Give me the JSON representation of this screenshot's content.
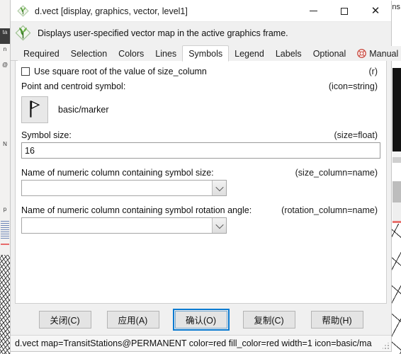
{
  "window": {
    "title": "d.vect [display, graphics, vector, level1]",
    "app_icon": "grass-logo-icon",
    "controls": {
      "minimize": "minimize-icon",
      "maximize": "maximize-icon",
      "close": "close-icon"
    }
  },
  "description": {
    "icon": "grass-logo-icon",
    "text": "Displays user-specified vector map in the active graphics frame."
  },
  "tabs": [
    {
      "label": "Required",
      "active": false,
      "icon": null
    },
    {
      "label": "Selection",
      "active": false,
      "icon": null
    },
    {
      "label": "Colors",
      "active": false,
      "icon": null
    },
    {
      "label": "Lines",
      "active": false,
      "icon": null
    },
    {
      "label": "Symbols",
      "active": true,
      "icon": null
    },
    {
      "label": "Legend",
      "active": false,
      "icon": null
    },
    {
      "label": "Labels",
      "active": false,
      "icon": null
    },
    {
      "label": "Optional",
      "active": false,
      "icon": null
    },
    {
      "label": "Manual",
      "active": false,
      "icon": "lifebuoy-icon"
    }
  ],
  "form": {
    "sqrt_checkbox": {
      "label": "Use square root of the value of size_column",
      "hint": "(r)",
      "checked": false
    },
    "symbol": {
      "label": "Point and centroid symbol:",
      "hint": "(icon=string)",
      "icon": "flag-marker-icon",
      "value": "basic/marker"
    },
    "symbol_size": {
      "label": "Symbol size:",
      "hint": "(size=float)",
      "value": "16",
      "placeholder": ""
    },
    "size_column": {
      "label": "Name of numeric column containing symbol size:",
      "hint": "(size_column=name)",
      "value": "",
      "arrow_icon": "chevron-down-icon"
    },
    "rotation_column": {
      "label": "Name of numeric column containing symbol rotation angle:",
      "hint": "(rotation_column=name)",
      "value": "",
      "arrow_icon": "chevron-down-icon"
    }
  },
  "buttons": [
    {
      "label": "关闭(C)",
      "focused": false,
      "name": "close-button"
    },
    {
      "label": "应用(A)",
      "focused": false,
      "name": "apply-button"
    },
    {
      "label": "确认(O)",
      "focused": true,
      "name": "ok-button"
    },
    {
      "label": "复制(C)",
      "focused": false,
      "name": "copy-button"
    },
    {
      "label": "帮助(H)",
      "focused": false,
      "name": "help-button"
    }
  ],
  "status": {
    "command": "d.vect map=TransitStations@PERMANENT color=red fill_color=red width=1 icon=basic/ma"
  },
  "background": {
    "right_edge_text": "ns",
    "accent_blue": "#0a7ad1",
    "dialog_bg": "#f0f0f0",
    "panel_bg": "#ffffff"
  }
}
